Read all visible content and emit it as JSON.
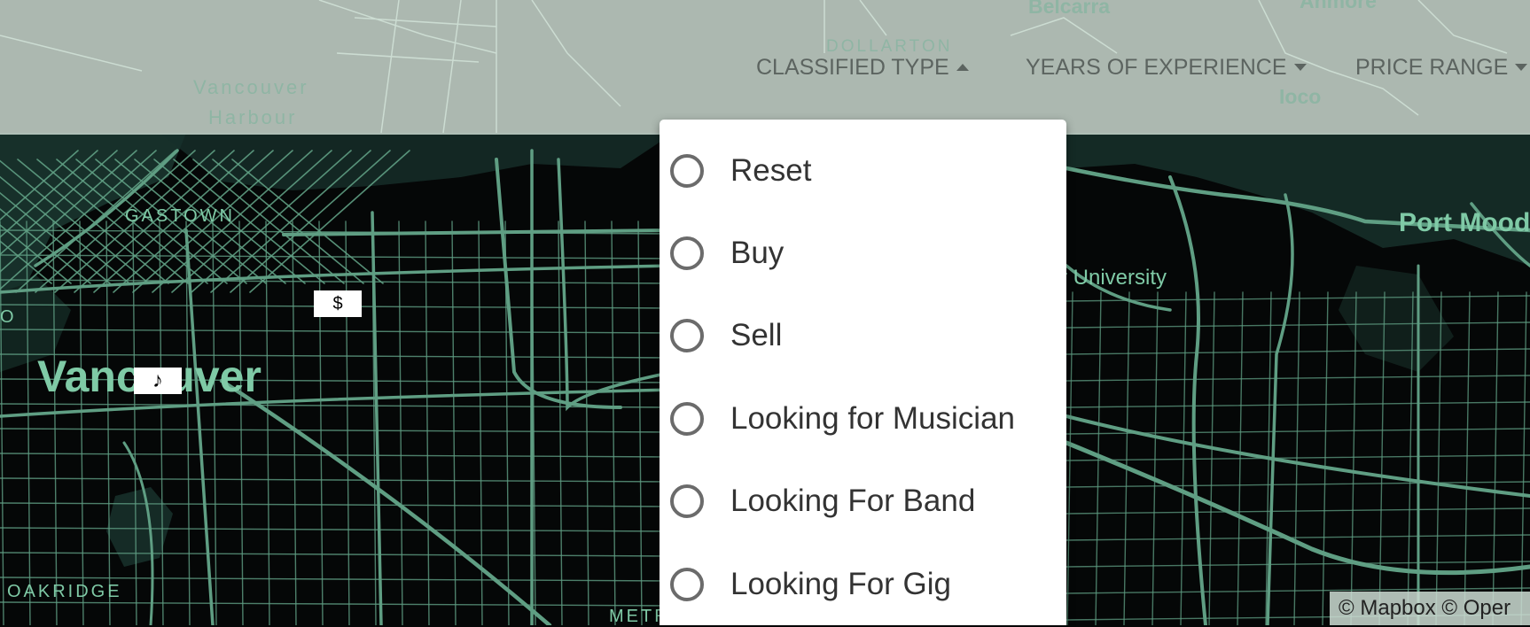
{
  "map": {
    "labels": {
      "gastown": "GASTOWN",
      "vancouver": "Vancouver",
      "oakridge": "OAKRIDGE",
      "port_moody": "Port Moody",
      "university": "r University",
      "metro": "METR",
      "vancouver_harbour_line1": "Vancouver",
      "vancouver_harbour_line2": "Harbour",
      "dollarton": "DOLLARTON",
      "belcarra": "Belcarra",
      "anmore": "Anmore",
      "ioco": "Ioco",
      "partial_o": "O"
    },
    "markers": [
      {
        "type": "sell",
        "symbol": "$"
      },
      {
        "type": "musician",
        "symbol": "♪"
      }
    ],
    "attribution": "© Mapbox © Oper",
    "colors": {
      "land": "#050707",
      "roads": "#5f9e83",
      "label": "#7fcaa6"
    }
  },
  "filters": {
    "classified_type": "CLASSIFIED TYPE",
    "years_experience": "YEARS OF EXPERIENCE",
    "price_range": "PRICE RANGE"
  },
  "dropdown": {
    "options": [
      {
        "label": "Reset",
        "selected": false
      },
      {
        "label": "Buy",
        "selected": false
      },
      {
        "label": "Sell",
        "selected": false
      },
      {
        "label": "Looking for Musician",
        "selected": false
      },
      {
        "label": "Looking For Band",
        "selected": false
      },
      {
        "label": "Looking For Gig",
        "selected": false
      }
    ]
  }
}
